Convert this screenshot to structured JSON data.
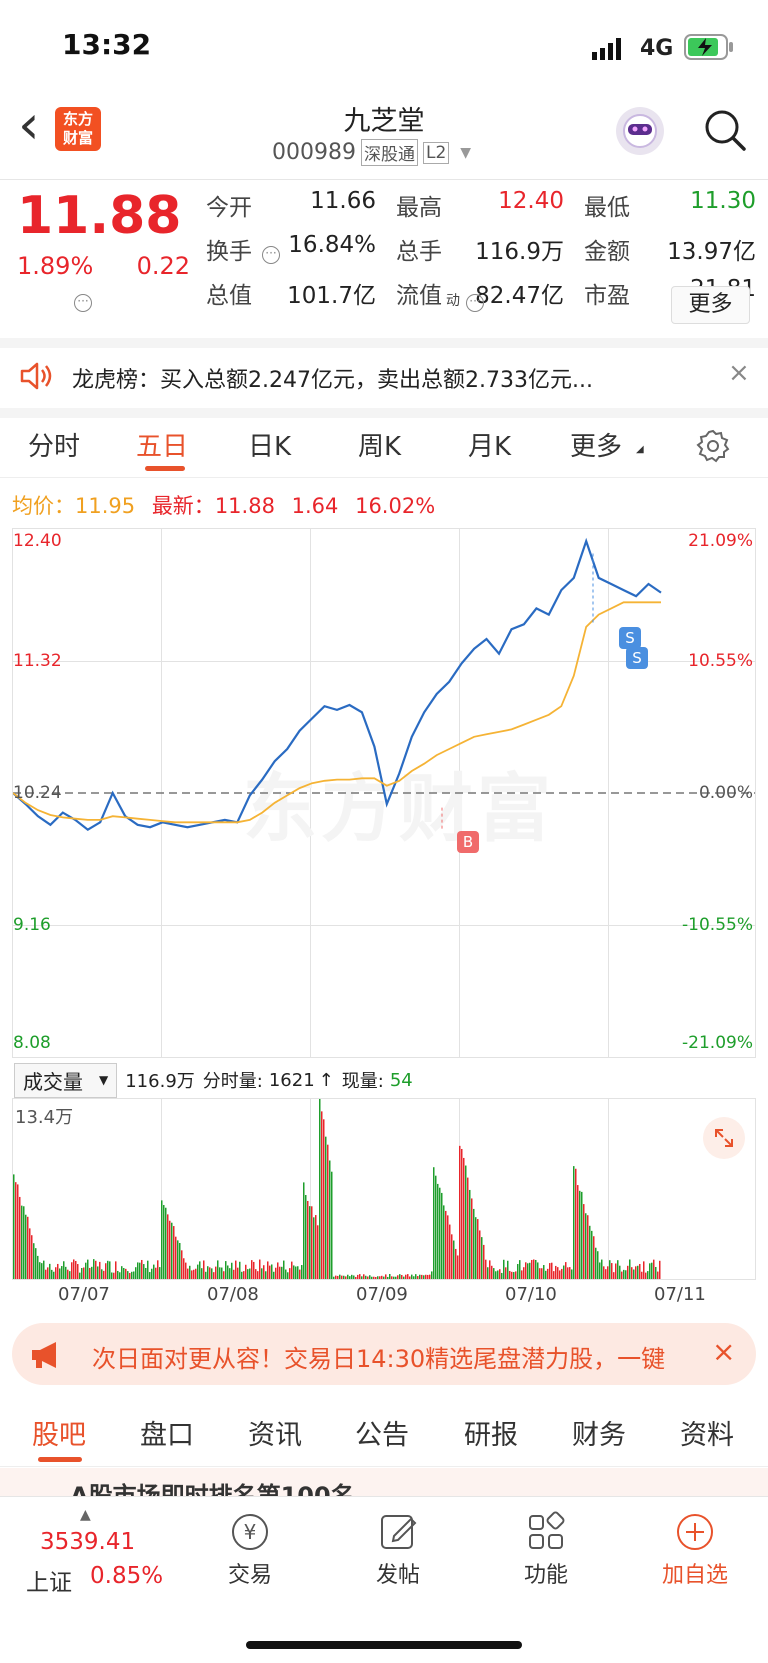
{
  "status_bar": {
    "time": "13:32",
    "network": "4G"
  },
  "header": {
    "back": "‹",
    "logo_line1": "东方",
    "logo_line2": "财富",
    "stock_name": "九芝堂",
    "stock_code": "000989",
    "tag_connect": "深股通",
    "tag_level": "L2"
  },
  "quote": {
    "price": "11.88",
    "change_pct": "1.89%",
    "change": "0.22",
    "rows": [
      [
        [
          "今开",
          "11.66",
          "#222"
        ],
        [
          "最高",
          "12.40",
          "#e8252b"
        ],
        [
          "最低",
          "11.30",
          "#1e9e2b"
        ]
      ],
      [
        [
          "换手",
          "16.84%",
          "#222"
        ],
        [
          "总手",
          "116.9万",
          "#222"
        ],
        [
          "金额",
          "13.97亿",
          "#222"
        ]
      ],
      [
        [
          "总值",
          "101.7亿",
          "#222"
        ],
        [
          "流值",
          "82.47亿",
          "#222"
        ],
        [
          "市盈",
          "21.81",
          "#222"
        ]
      ]
    ],
    "pe_sup": "动",
    "more": "更多"
  },
  "notice": {
    "text": "龙虎榜：买入总额2.247亿元，卖出总额2.733亿元..."
  },
  "tabs": [
    "分时",
    "五日",
    "日K",
    "周K",
    "月K",
    "更多"
  ],
  "active_tab": "五日",
  "legend": {
    "avg_label": "均价：",
    "avg_value": "11.95",
    "latest_label": "最新：",
    "latest_value": "11.88",
    "latest_change": "1.64",
    "latest_pct": "16.02%"
  },
  "colors": {
    "accent": "#e8522b",
    "up": "#e8252b",
    "down": "#1e9e2b",
    "price_line": "#2a6bc2",
    "avg_line": "#f5b335"
  },
  "chart_data": {
    "type": "line",
    "left_axis": [
      "12.40",
      "11.32",
      "10.24",
      "9.16",
      "8.08"
    ],
    "right_axis": [
      "21.09%",
      "10.55%",
      "0.00%",
      "-10.55%",
      "-21.09%"
    ],
    "x_labels": [
      "07/07",
      "07/08",
      "07/09",
      "07/10",
      "07/11"
    ],
    "ylim": [
      8.08,
      12.4
    ],
    "prev_close": 10.24,
    "watermark": "东方财富",
    "markers": [
      "B",
      "S",
      "S"
    ],
    "series": [
      {
        "values": [
          10.24,
          10.15,
          10.05,
          9.98,
          10.08,
          10.02,
          9.94,
          10.0,
          10.24,
          10.05,
          9.98,
          9.96,
          10.0,
          9.98,
          9.96,
          9.98,
          10.0,
          10.02,
          10.0,
          10.22,
          10.35,
          10.5,
          10.6,
          10.75,
          10.85,
          10.95,
          10.92,
          10.96,
          10.9,
          10.62,
          10.15,
          10.4,
          10.7,
          10.9,
          11.05,
          11.15,
          11.3,
          11.42,
          11.5,
          11.38,
          11.58,
          11.62,
          11.75,
          11.7,
          11.9,
          12.0,
          12.3,
          12.0,
          11.95,
          11.9,
          11.85,
          11.95,
          11.88
        ]
      },
      {
        "values": [
          10.24,
          10.16,
          10.1,
          10.06,
          10.04,
          10.03,
          10.02,
          10.02,
          10.05,
          10.04,
          10.03,
          10.02,
          10.01,
          10.0,
          10.0,
          10.0,
          10.0,
          10.0,
          10.0,
          10.02,
          10.08,
          10.16,
          10.22,
          10.28,
          10.32,
          10.34,
          10.35,
          10.35,
          10.36,
          10.36,
          10.3,
          10.34,
          10.42,
          10.48,
          10.55,
          10.6,
          10.65,
          10.7,
          10.72,
          10.74,
          10.76,
          10.8,
          10.84,
          10.88,
          10.95,
          11.2,
          11.6,
          11.7,
          11.75,
          11.8,
          11.8,
          11.8,
          11.8
        ]
      }
    ]
  },
  "volume": {
    "selector": "成交量",
    "total": "116.9万",
    "period_label": "分时量:",
    "period_value": "1621",
    "now_label": "现量:",
    "now_value": "54",
    "axis_top": "13.4万"
  },
  "promo": {
    "text": "次日面对更从容！交易日14:30精选尾盘潜力股，一键"
  },
  "bottom_tabs": [
    "股吧",
    "盘口",
    "资讯",
    "公告",
    "研报",
    "财务",
    "资料"
  ],
  "bottom_tab_active": "股吧",
  "peek": {
    "text": "A股市场即时排名第100名"
  },
  "bottom_bar": {
    "index_value": "3539.41",
    "index_name": "上证",
    "index_pct": "0.85%",
    "trade": "交易",
    "post": "发帖",
    "func": "功能",
    "add": "加自选"
  }
}
